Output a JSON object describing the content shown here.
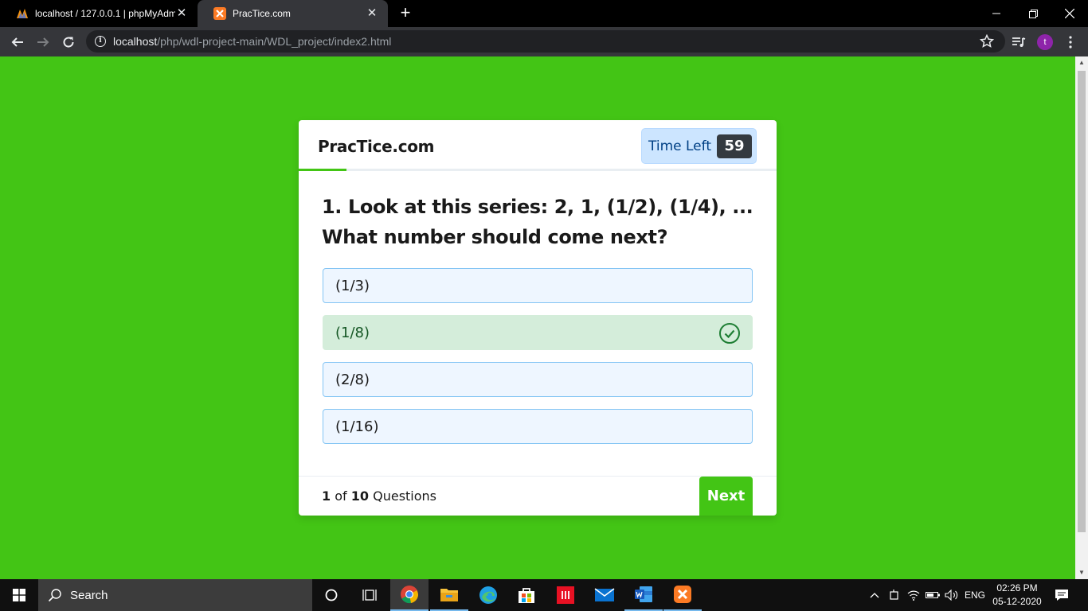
{
  "browser": {
    "tabs": [
      {
        "title": "localhost / 127.0.0.1 | phpMyAdmin",
        "active": false
      },
      {
        "title": "PracTice.com",
        "active": true
      }
    ],
    "url_host": "localhost",
    "url_path": "/php/wdl-project-main/WDL_project/index2.html",
    "profile_initial": "t"
  },
  "quiz": {
    "site_title": "PracTice.com",
    "timer_label": "Time Left",
    "timer_value": "59",
    "question_line1": "1. Look at this series: 2, 1, (1/2), (1/4), ...",
    "question_line2": "What number should come next?",
    "options": [
      "(1/3)",
      "(1/8)",
      "(2/8)",
      "(1/16)"
    ],
    "correct_option_index": 1,
    "progress_fraction": 0.1,
    "current_question": "1",
    "of_word": "of",
    "total_questions": "10",
    "questions_word": "Questions",
    "next_label": "Next"
  },
  "colors": {
    "page_bg": "#43c515",
    "correct_bg": "#d4edda",
    "option_bg": "#eef6ff",
    "timer_bg": "#cce5ff"
  },
  "taskbar": {
    "search_placeholder": "Search",
    "language": "ENG",
    "time": "02:26 PM",
    "date": "05-12-2020"
  }
}
